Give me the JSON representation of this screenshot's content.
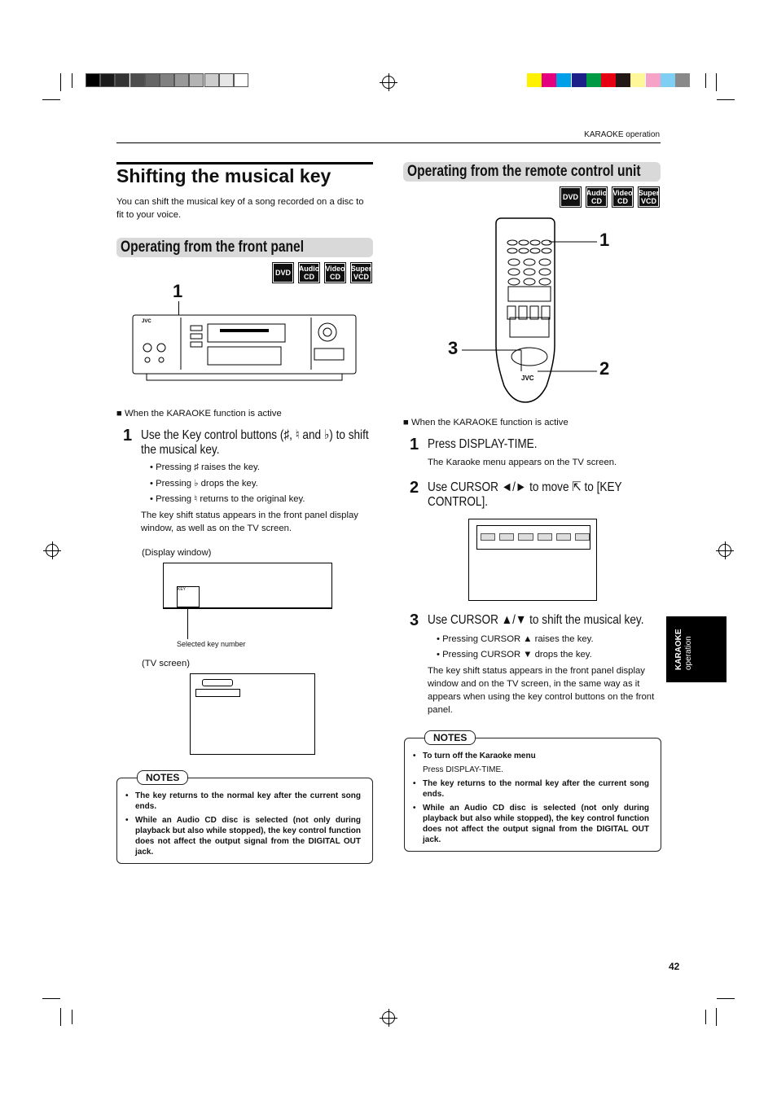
{
  "header": {
    "section": "KARAOKE operation"
  },
  "colors": {
    "grays": [
      "#000000",
      "#1a1a1a",
      "#333333",
      "#4d4d4d",
      "#666666",
      "#808080",
      "#999999",
      "#b3b3b3",
      "#cccccc",
      "#e6e6e6",
      "#ffffff"
    ],
    "process": [
      "#fff100",
      "#e4007f",
      "#00a0e9",
      "#1d2088",
      "#009944",
      "#e60012",
      "#231815",
      "#fff799",
      "#f5a3c7",
      "#7fcef4",
      "#898989"
    ],
    "header_bg": "#d9d9d9"
  },
  "left": {
    "title": "Shifting the musical key",
    "intro": "You can shift the musical key of a song recorded on a disc to fit to your voice.",
    "section": "Operating from the front panel",
    "badges": [
      [
        "DVD",
        ""
      ],
      [
        "Audio",
        "CD"
      ],
      [
        "Video",
        "CD"
      ],
      [
        "Super",
        "VCD"
      ]
    ],
    "callout": "1",
    "condition": "■ When the KARAOKE function is active",
    "step1": {
      "num": "1",
      "text": "Use the Key control buttons (♯, ♮ and ♭) to shift the musical key."
    },
    "bullets": [
      "Pressing ♯ raises the key.",
      "Pressing ♭ drops the key.",
      "Pressing ♮ returns to the original key."
    ],
    "para": "The key shift status appears in the front panel display window, as well as on the TV screen.",
    "display_label": "(Display window)",
    "display_key": "KEY",
    "selected_label": "Selected key number",
    "tv_label": "(TV screen)",
    "notes_label": "NOTES",
    "notes": [
      "The key returns to the normal key after the current song ends.",
      "While an Audio CD disc is selected (not only during playback but also while stopped), the key control function does not affect the output signal from the DIGITAL OUT jack."
    ]
  },
  "right": {
    "section": "Operating from the remote control unit",
    "badges": [
      [
        "DVD",
        ""
      ],
      [
        "Audio",
        "CD"
      ],
      [
        "Video",
        "CD"
      ],
      [
        "Super",
        "VCD"
      ]
    ],
    "callouts": [
      "1",
      "3",
      "2"
    ],
    "remote_brand": "JVC",
    "condition": "■ When the KARAOKE function is active",
    "step1": {
      "num": "1",
      "text": "Press DISPLAY-TIME."
    },
    "step1_desc": "The Karaoke menu appears on the TV screen.",
    "step2": {
      "num": "2",
      "text": "Use CURSOR ◄/► to move ⇱ to [KEY CONTROL]."
    },
    "step3": {
      "num": "3",
      "text": "Use CURSOR ▲/▼ to shift the musical key."
    },
    "bullets": [
      "Pressing CURSOR ▲ raises the key.",
      "Pressing CURSOR ▼ drops the key."
    ],
    "para": "The key shift status appears in the front panel display window and on the TV screen, in the same way as it appears when using the key control buttons on the front panel.",
    "notes_label": "NOTES",
    "notes": [
      {
        "title": "To turn off the Karaoke menu",
        "body": "Press DISPLAY-TIME."
      },
      {
        "title": "The key returns to the normal key after the current song ends.",
        "body": ""
      },
      {
        "title": "While an Audio CD disc is selected (not only during playback but also while stopped), the key control function does not affect the output signal from the DIGITAL OUT jack.",
        "body": ""
      }
    ]
  },
  "side_tab": {
    "line1": "KARAOKE",
    "line2": "operation"
  },
  "page_number": "42"
}
